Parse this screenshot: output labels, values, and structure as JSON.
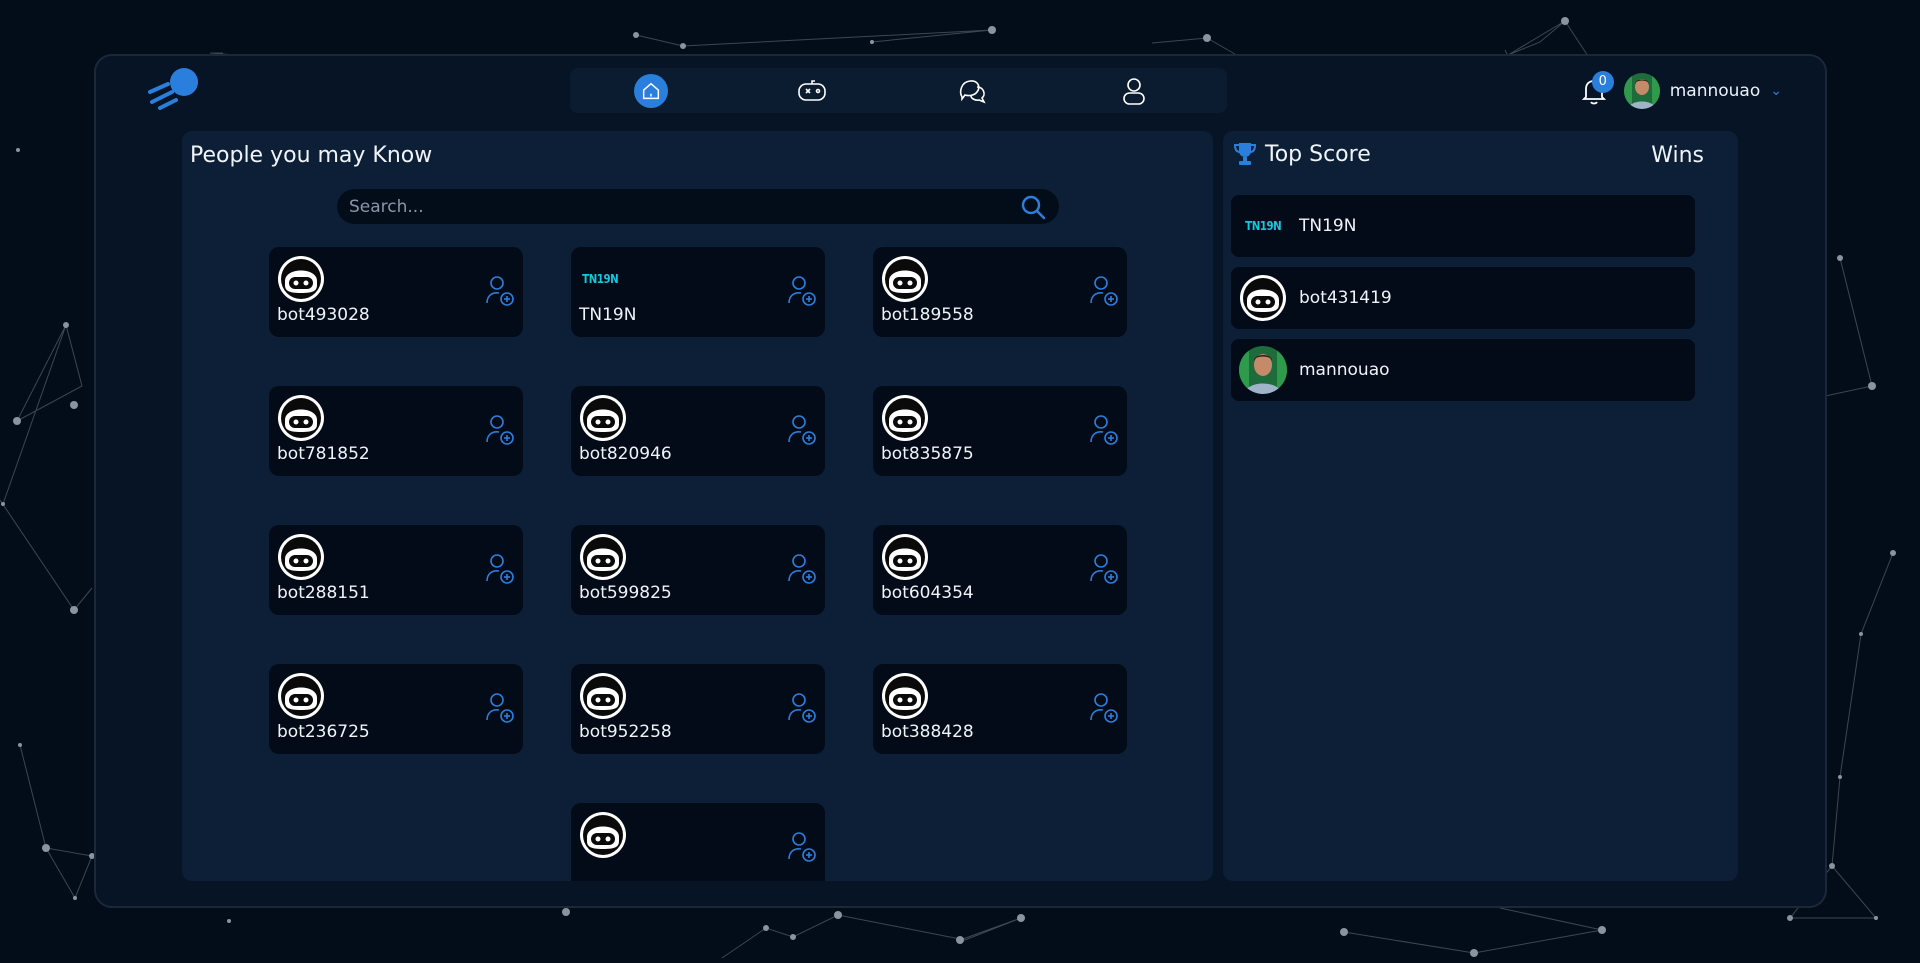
{
  "nav": {
    "items": [
      {
        "icon": "home-icon",
        "active": true
      },
      {
        "icon": "gamepad-icon",
        "active": false
      },
      {
        "icon": "chat-icon",
        "active": false
      },
      {
        "icon": "profile-icon",
        "active": false
      }
    ]
  },
  "header": {
    "notification_count": "0",
    "username": "mannouao",
    "chevron": "⌄"
  },
  "people": {
    "title": "People you may Know",
    "search_placeholder": "Search...",
    "cards": [
      {
        "name": "bot493028",
        "avatar": "bot"
      },
      {
        "name": "TN19N",
        "avatar": "tn19n"
      },
      {
        "name": "bot189558",
        "avatar": "bot"
      },
      {
        "name": "bot781852",
        "avatar": "bot"
      },
      {
        "name": "bot820946",
        "avatar": "bot"
      },
      {
        "name": "bot835875",
        "avatar": "bot"
      },
      {
        "name": "bot288151",
        "avatar": "bot"
      },
      {
        "name": "bot599825",
        "avatar": "bot"
      },
      {
        "name": "bot604354",
        "avatar": "bot"
      },
      {
        "name": "bot236725",
        "avatar": "bot"
      },
      {
        "name": "bot952258",
        "avatar": "bot"
      },
      {
        "name": "bot388428",
        "avatar": "bot"
      },
      {
        "name": "",
        "avatar": "bot"
      }
    ]
  },
  "top_score": {
    "title": "Top Score",
    "wins_label": "Wins",
    "rows": [
      {
        "name": "TN19N",
        "avatar": "tn19n"
      },
      {
        "name": "bot431419",
        "avatar": "bot"
      },
      {
        "name": "mannouao",
        "avatar": "photo"
      }
    ]
  },
  "tn19n_logo_text": "TN19N",
  "colors": {
    "accent": "#2b7fdc",
    "panel": "#0c1f37",
    "card": "#020b17",
    "background": "#030d1a"
  }
}
